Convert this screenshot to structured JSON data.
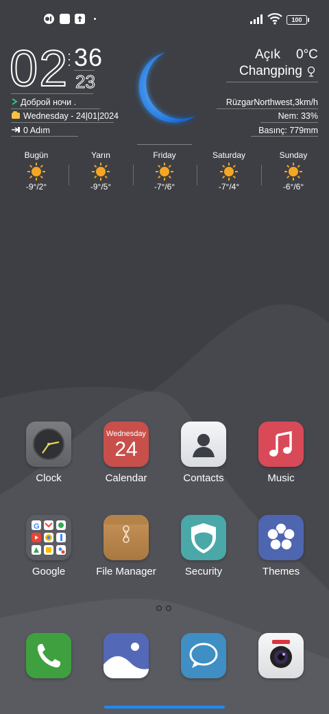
{
  "status_bar": {
    "icons": [
      "app-notification-icon",
      "square-notification-icon",
      "upload-notification-icon"
    ],
    "battery": "100"
  },
  "clock": {
    "hour": "02",
    "minute": "36",
    "second": "23",
    "greeting": "Доброй ночи .",
    "date": "Wednesday - 24|01|2024",
    "steps": "0 Adım"
  },
  "weather": {
    "condition": "Açık",
    "temperature": "0°C",
    "city": "Changping",
    "wind": "RüzgarNorthwest,3km/h",
    "humidity": "Nem: 33%",
    "pressure": "Basınç: 779mm",
    "forecast": [
      {
        "day": "Bugün",
        "temp": "-9°/2°"
      },
      {
        "day": "Yarın",
        "temp": "-9°/5°"
      },
      {
        "day": "Friday",
        "temp": "-7°/6°"
      },
      {
        "day": "Saturday",
        "temp": "-7°/4°"
      },
      {
        "day": "Sunday",
        "temp": "-6°/6°"
      }
    ]
  },
  "apps": {
    "clock": "Clock",
    "calendar": "Calendar",
    "calendar_weekday": "Wednesday",
    "calendar_day": "24",
    "contacts": "Contacts",
    "music": "Music",
    "google": "Google",
    "file_manager": "File Manager",
    "security": "Security",
    "themes": "Themes"
  },
  "dock": [
    "phone",
    "gallery",
    "messages",
    "camera"
  ],
  "colors": {
    "background": "#3d3f44",
    "moon": "#2a8cff",
    "sun": "#f5a623",
    "nav_indicator": "#1a8cff"
  }
}
